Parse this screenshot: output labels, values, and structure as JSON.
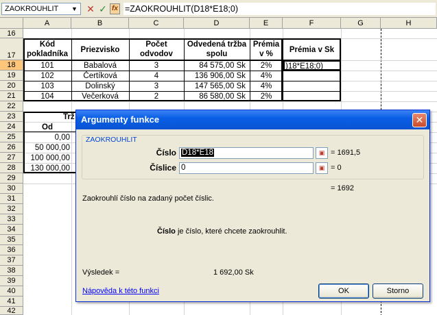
{
  "formula_bar": {
    "name_box": "ZAOKROUHLIT",
    "cancel_glyph": "✕",
    "enter_glyph": "✓",
    "insert_function_glyph": "fx",
    "formula": "=ZAOKROUHLIT(D18*E18;0)"
  },
  "columns": [
    "A",
    "B",
    "C",
    "D",
    "E",
    "F",
    "G",
    "H"
  ],
  "rows": [
    "16",
    "17",
    "18",
    "19",
    "20",
    "21",
    "22",
    "23",
    "24",
    "25",
    "26",
    "27",
    "28",
    "29",
    "30",
    "31",
    "32",
    "33",
    "34",
    "35",
    "36",
    "37",
    "38",
    "39",
    "40",
    "41",
    "42"
  ],
  "table": {
    "headers": {
      "kod": [
        "Kód",
        "pokladníka"
      ],
      "priezvisko": "Priezvisko",
      "pocet": [
        "Počet",
        "odvodov"
      ],
      "trzba": [
        "Odvedená tržba",
        "spolu"
      ],
      "premia_pct": [
        "Prémia",
        "v %"
      ],
      "premia_sk": "Prémia v Sk"
    },
    "rows": [
      {
        "kod": "101",
        "priezvisko": "Babalová",
        "pocet": "3",
        "trzba": "84 575,00 Sk",
        "pct": "2%",
        "sk": ")18*E18;0)"
      },
      {
        "kod": "102",
        "priezvisko": "Čertíková",
        "pocet": "4",
        "trzba": "136 906,00 Sk",
        "pct": "4%",
        "sk": ""
      },
      {
        "kod": "103",
        "priezvisko": "Dolinský",
        "pocet": "3",
        "trzba": "147 565,00 Sk",
        "pct": "4%",
        "sk": ""
      },
      {
        "kod": "104",
        "priezvisko": "Večerková",
        "pocet": "2",
        "trzba": "86 580,00 Sk",
        "pct": "2%",
        "sk": ""
      }
    ]
  },
  "lower_table": {
    "title_fragment": "Trž",
    "header": "Od",
    "values": [
      "0,00",
      "50 000,00",
      "100 000,00",
      "130 000,00"
    ]
  },
  "dialog": {
    "title": "Argumenty funkce",
    "close_glyph": "✕",
    "function_name": "ZAOKROUHLIT",
    "arg1_label": "Číslo",
    "arg1_value": "D18*E18",
    "arg1_result": "= 1691,5",
    "arg2_label": "Číslice",
    "arg2_value": "0",
    "arg2_result": "= 0",
    "formula_result": "= 1692",
    "description": "Zaokrouhlí číslo na zadaný počet číslic.",
    "arg_help_bold": "Číslo",
    "arg_help_rest": " je číslo, které chcete zaokrouhlit.",
    "result_label": "Výsledek =",
    "result_value": "1 692,00 Sk",
    "help_link": "Nápověda k této funkci",
    "ok_label": "OK",
    "cancel_label": "Storno"
  },
  "colors": {
    "selection_header": "#ffc67a",
    "dialog_title": "#0a5fe6",
    "group_label": "#0046d5"
  }
}
